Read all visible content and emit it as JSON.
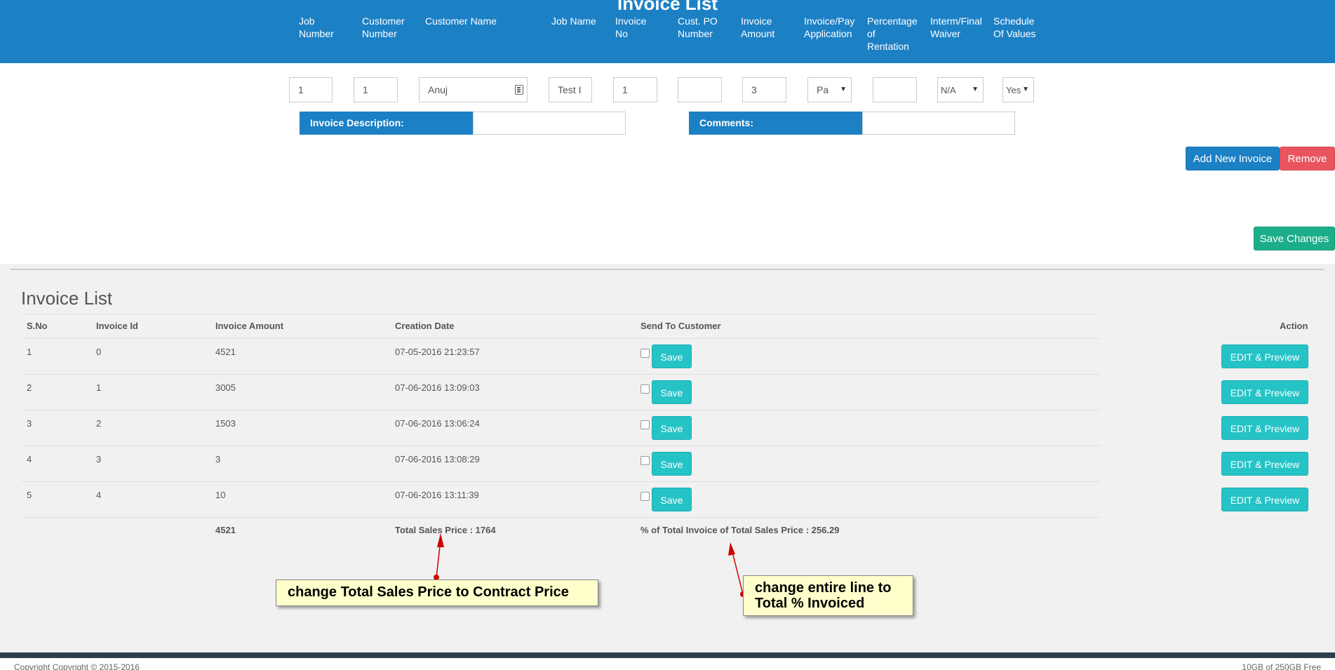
{
  "header": {
    "title": "Invoice List",
    "columns": [
      "Job\nNumber",
      "Customer\nNumber",
      "Customer Name",
      "Job Name",
      "Invoice\nNo",
      "Cust. PO\nNumber",
      "Invoice\nAmount",
      "Invoice/Pay\nApplication",
      "Percentage\nof\nRentation",
      "Interm/Final\nWaiver",
      "Schedule\nOf Values"
    ]
  },
  "form": {
    "job_number": "1",
    "customer_number": "1",
    "customer_name": "Anuj",
    "job_name": "Test I",
    "invoice_no": "1",
    "cust_po_number": "",
    "invoice_amount": "3",
    "invoice_pay_application": "Pa",
    "percentage_retention": "",
    "interm_final_waiver": "N/A",
    "schedule_of_values": "Yes",
    "invoice_description_label": "Invoice Description:",
    "invoice_description_value": "",
    "comments_label": "Comments:",
    "comments_value": "",
    "add_new_invoice_label": "Add New Invoice",
    "remove_label": "Remove",
    "save_changes_label": "Save Changes"
  },
  "invoice_list": {
    "title": "Invoice List",
    "headers": {
      "sno": "S.No",
      "invoice_id": "Invoice Id",
      "invoice_amount": "Invoice Amount",
      "creation_date": "Creation Date",
      "send_to_customer": "Send To Customer",
      "action": "Action"
    },
    "rows": [
      {
        "sno": "1",
        "invoice_id": "0",
        "amount": "4521",
        "date": "07-05-2016 21:23:57",
        "save_label": "Save",
        "action_label": "EDIT & Preview"
      },
      {
        "sno": "2",
        "invoice_id": "1",
        "amount": "3005",
        "date": "07-06-2016 13:09:03",
        "save_label": "Save",
        "action_label": "EDIT & Preview"
      },
      {
        "sno": "3",
        "invoice_id": "2",
        "amount": "1503",
        "date": "07-06-2016 13:06:24",
        "save_label": "Save",
        "action_label": "EDIT & Preview"
      },
      {
        "sno": "4",
        "invoice_id": "3",
        "amount": "3",
        "date": "07-06-2016 13:08:29",
        "save_label": "Save",
        "action_label": "EDIT & Preview"
      },
      {
        "sno": "5",
        "invoice_id": "4",
        "amount": "10",
        "date": "07-06-2016 13:11:39",
        "save_label": "Save",
        "action_label": "EDIT & Preview"
      }
    ],
    "totals": {
      "amount": "4521",
      "total_sales_price": "Total Sales Price : 1764",
      "percent_invoiced": "% of Total Invoice of Total Sales Price : 256.29"
    }
  },
  "annotations": {
    "callout_1": "change Total Sales Price to Contract Price",
    "callout_2_line1": "change entire line to",
    "callout_2_line2": "Total % Invoiced"
  },
  "footer": {
    "left": "Copyright Copyright © 2015-2016",
    "right": "10GB of 250GB Free"
  },
  "colors": {
    "primary_blue": "#1c80c5",
    "danger_red": "#e9545f",
    "success_green": "#1cae8a",
    "cyan_button": "#25c3c6",
    "callout_bg": "#ffffcc",
    "arrow_red": "#cc0000"
  }
}
